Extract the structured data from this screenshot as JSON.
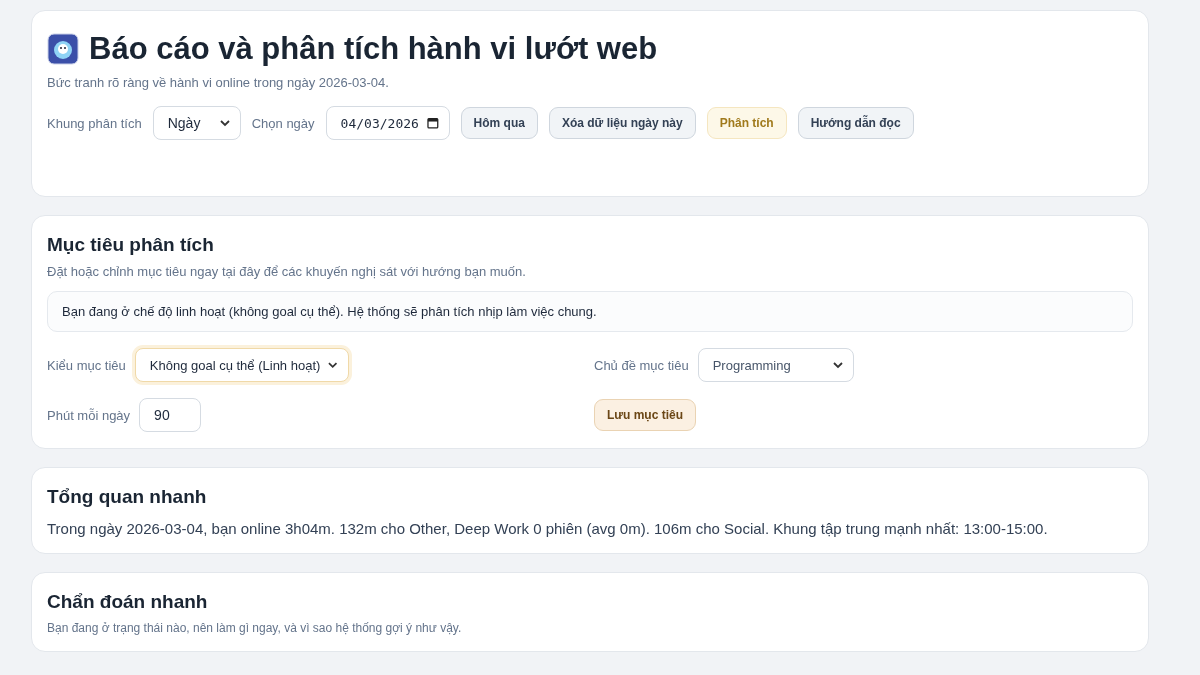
{
  "header": {
    "title": "Báo cáo và phân tích hành vi lướt web",
    "subtitle": "Bức tranh rõ ràng về hành vi online trong ngày 2026-03-04.",
    "controls": [
      {
        "kind": "select",
        "label": "Khung phân tích",
        "value": "Ngày"
      },
      {
        "kind": "date",
        "label": "Chọn ngày",
        "value": "04/03/2026"
      }
    ],
    "buttons": [
      {
        "label": "Hôm qua",
        "kind": "default"
      },
      {
        "label": "Xóa dữ liệu ngày này",
        "kind": "default"
      },
      {
        "label": "Phân tích",
        "kind": "accent"
      },
      {
        "label": "Hướng dẫn đọc",
        "kind": "default"
      }
    ]
  },
  "goal": {
    "title": "Mục tiêu phân tích",
    "hint": "Đặt hoặc chỉnh mục tiêu ngay tại đây để các khuyến nghị sát với hướng bạn muốn.",
    "notice": "Bạn đang ở chế độ linh hoạt (không goal cụ thể). Hệ thống sẽ phân tích nhịp làm việc chung.",
    "fields": [
      {
        "kind": "select",
        "label": "Kiểu mục tiêu",
        "value": "Không goal cụ thể (Linh hoạt)",
        "focused": true
      },
      {
        "kind": "select",
        "label": "Chủ đề mục tiêu",
        "value": "Programming",
        "focused": false
      },
      {
        "kind": "input",
        "label": "Phút mỗi ngày",
        "value": "90",
        "focused": false
      },
      {
        "kind": "button",
        "label": "Lưu mục tiêu"
      }
    ]
  },
  "overview": {
    "title": "Tổng quan nhanh",
    "text": "Trong ngày 2026-03-04, bạn online 3h04m. 132m cho Other, Deep Work 0 phiên (avg 0m). 106m cho Social. Khung tập trung mạnh nhất: 13:00-15:00."
  },
  "diagnosis": {
    "title": "Chẩn đoán nhanh",
    "hint": "Bạn đang ở trạng thái nào, nên làm gì ngay, và vì sao hệ thống gợi ý như vậy."
  }
}
